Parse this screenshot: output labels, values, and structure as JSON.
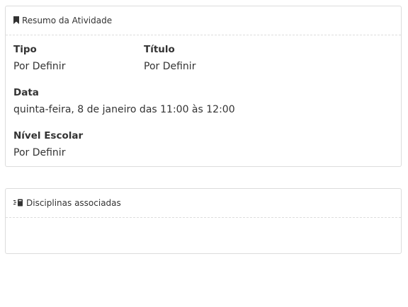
{
  "summary": {
    "title": "Resumo da Atividade",
    "icon": "bookmark-icon",
    "fields": {
      "tipo": {
        "label": "Tipo",
        "value": "Por Definir"
      },
      "titulo": {
        "label": "Título",
        "value": "Por Definir"
      },
      "data": {
        "label": "Data",
        "value": "quinta-feira, 8 de janeiro das 11:00 às 12:00"
      },
      "nivel": {
        "label": "Nível Escolar",
        "value": "Por Definir"
      }
    }
  },
  "disciplines": {
    "title": "Disciplinas associadas",
    "icon": "book-list-icon"
  }
}
